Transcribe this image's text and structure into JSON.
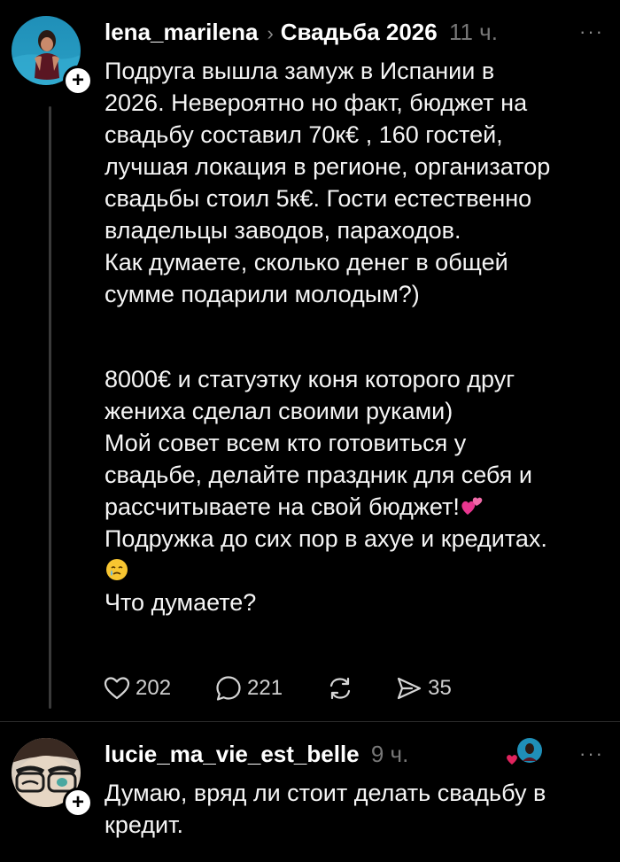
{
  "post1": {
    "username": "lena_marilena",
    "community": "Свадьба 2026",
    "time": "11 ч.",
    "more": "···",
    "follow": "+",
    "paragraph1": [
      "Подруга вышла замуж в Испании в",
      "2026. Невероятно но факт, бюджет на",
      "свадьбу составил 70к€ , 160 гостей,",
      "лучшая локация в регионе, организатор",
      "свадьбы стоил 5к€. Гости естественно",
      "владельцы заводов, параходов.",
      "Как думаете, сколько денег в общей",
      "сумме подарили молодым?)"
    ],
    "paragraph2": [
      "8000€  и статуэтку коня которого друг",
      "жениха сделал своими руками)",
      "Мой совет всем кто готовиться у",
      "свадьбе, делайте праздник для себя и",
      "рассчитываете на свой бюджет!",
      "Подружка до сих пор в ахуе и кредитах.",
      "",
      "Что думаете?"
    ],
    "actions": {
      "likes": "202",
      "comments": "221",
      "shares": "35"
    }
  },
  "post2": {
    "username": "lucie_ma_vie_est_belle",
    "time": "9 ч.",
    "more": "···",
    "follow": "+",
    "paragraph1": [
      "Думаю, вряд ли стоит делать свадьбу в",
      "кредит."
    ]
  },
  "colors": {
    "background": "#000000",
    "text": "#f5f5f5",
    "muted": "#777777",
    "heart": "#e0245e"
  },
  "icons": [
    "heart-icon",
    "comment-icon",
    "repost-icon",
    "share-icon",
    "more-icon",
    "two-hearts-emoji",
    "crying-face-emoji",
    "plus-icon"
  ]
}
